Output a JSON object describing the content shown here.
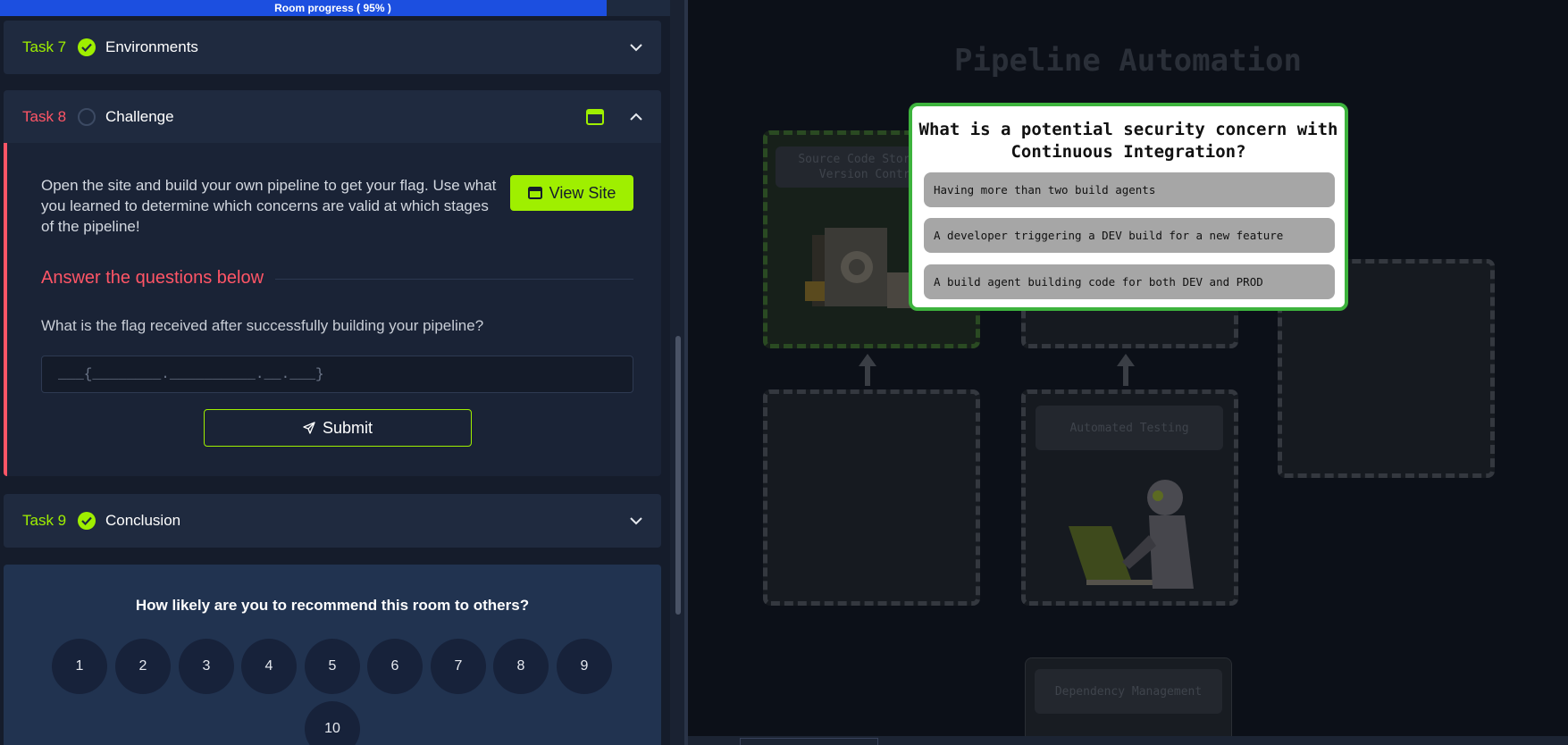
{
  "progress": {
    "label": "Room progress ( 95% )",
    "percent": 95
  },
  "tasks": {
    "task7": {
      "number": "Task 7",
      "title": "Environments",
      "status": "completed"
    },
    "task8": {
      "number": "Task 8",
      "title": "Challenge",
      "status": "incomplete"
    },
    "task9": {
      "number": "Task 9",
      "title": "Conclusion",
      "status": "completed"
    }
  },
  "task8_body": {
    "instructions": "Open the site and build your own pipeline to get your flag. Use what you learned to determine which concerns are valid at which stages of the pipeline!",
    "view_site_label": "View Site",
    "answer_heading": "Answer the questions below",
    "question": "What is the flag received after successfully building your pipeline?",
    "answer_placeholder": "___{________.__________.__.___}",
    "submit_label": "Submit"
  },
  "rating": {
    "title": "How likely are you to recommend this room to others?",
    "options": [
      "1",
      "2",
      "3",
      "4",
      "5",
      "6",
      "7",
      "8",
      "9",
      "10"
    ]
  },
  "site": {
    "title": "Pipeline Automation",
    "slots": {
      "source_code": "Source Code Storage & Version Control",
      "automated_testing": "Automated Testing",
      "dependency_management": "Dependency Management"
    },
    "popup": {
      "question": "What is a potential security concern with Continuous Integration?",
      "options": [
        "Having more than two build agents",
        "A developer triggering a DEV build for a new feature",
        "A build agent building code for both DEV and PROD"
      ]
    }
  },
  "colors": {
    "accent": "#9fef00",
    "danger": "#ff5566",
    "progress": "#1c4fe0",
    "popup_border": "#3db33d"
  }
}
